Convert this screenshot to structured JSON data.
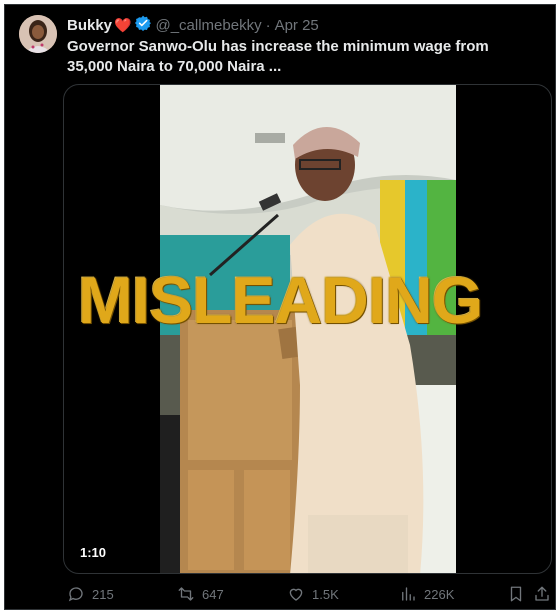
{
  "tweet": {
    "display_name": "Bukky",
    "name_emoji": "❤️",
    "handle": "@_callmebekky",
    "separator": "·",
    "date": "Apr 25",
    "text": "Governor Sanwo-Olu has increase the minimum wage from 35,000 Naira to 70,000 Naira ..."
  },
  "media": {
    "duration": "1:10",
    "overlay_stamp": "MISLEADING"
  },
  "actions": {
    "replies": "215",
    "reposts": "647",
    "likes": "1.5K",
    "views": "226K"
  },
  "colors": {
    "background": "#000000",
    "text": "#e7e9ea",
    "muted": "#71767b",
    "verified": "#1d9bf0",
    "stamp": "#e0a81a"
  },
  "icons": [
    "verified-badge-icon",
    "reply-icon",
    "repost-icon",
    "like-icon",
    "views-icon",
    "bookmark-icon",
    "share-icon"
  ]
}
